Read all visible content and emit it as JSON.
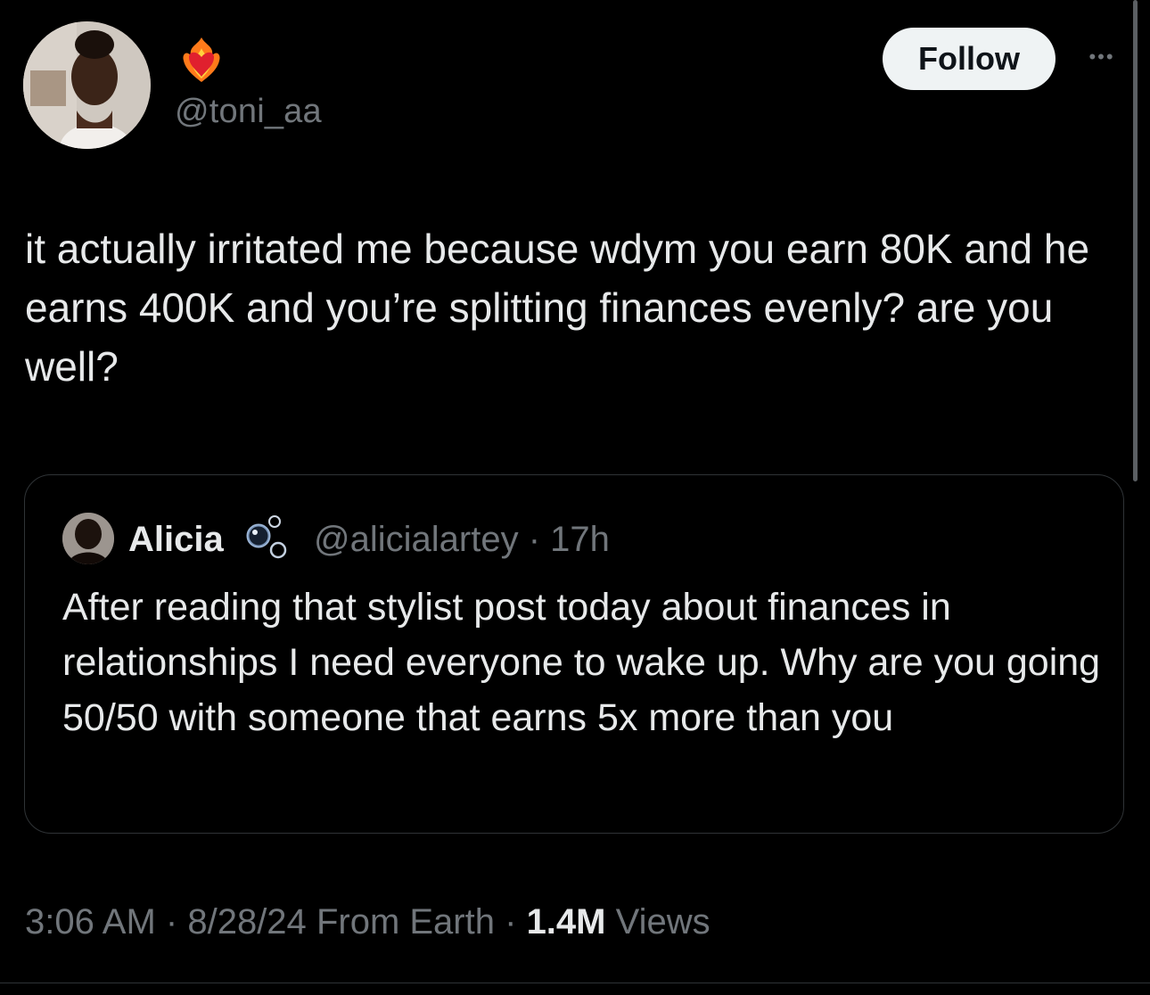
{
  "author": {
    "display_name_emoji": "heart-on-fire",
    "handle": "@toni_aa"
  },
  "actions": {
    "follow_label": "Follow",
    "more_label": "•••"
  },
  "tweet": {
    "text": "it actually irritated me because wdym you earn 80K and he earns 400K and you’re splitting finances evenly? are you well?"
  },
  "quoted_tweet": {
    "author_name": "Alicia",
    "name_emoji": "bubbles",
    "handle": "@alicialartey",
    "separator": "·",
    "time": "17h",
    "text": "After reading that stylist post today about finances in relationships I need everyone to wake up. Why are you going 50/50 with someone that earns 5x more than you"
  },
  "meta": {
    "time": "3:06 AM",
    "sep1": "·",
    "date": "8/28/24",
    "source": "From Earth",
    "sep2": "·",
    "views_count": "1.4M",
    "views_label": "Views"
  },
  "colors": {
    "background": "#000000",
    "text_primary": "#e7e9ea",
    "text_secondary": "#71767b",
    "border": "#2f3336",
    "follow_bg": "#eff3f4"
  }
}
